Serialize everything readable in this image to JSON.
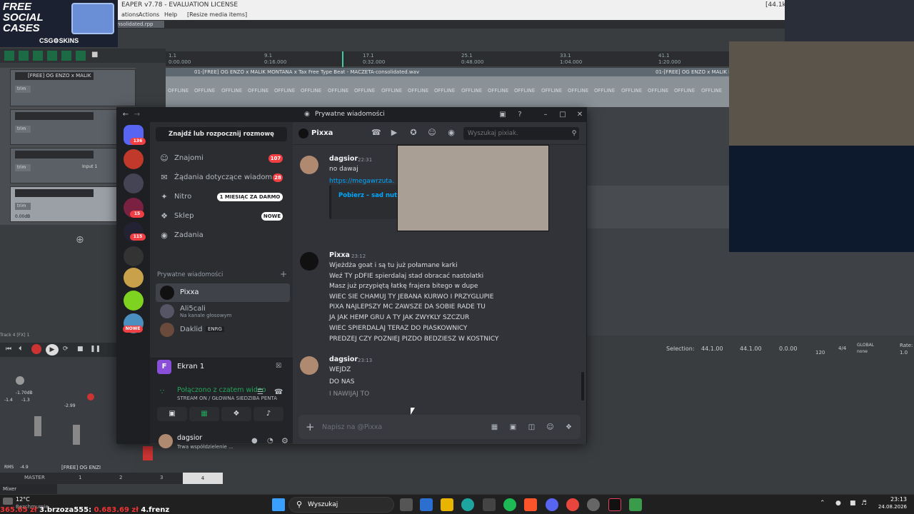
{
  "reaper": {
    "title": "EAPER v7.78 - EVALUATION LICENSE",
    "menu": [
      "ations",
      "Actions",
      "Help",
      "[Resize media items]"
    ],
    "samplerate": "[44.1kHz",
    "tab": "nsolidated.rpp",
    "ruler": [
      "1.1",
      "9.1",
      "17.1",
      "25.1",
      "33.1",
      "41.1"
    ],
    "ruler_times": [
      "0:00.000",
      "0:16.000",
      "0:32.000",
      "0:48.000",
      "1:04.000",
      "1:20.000"
    ],
    "clip_label": "01-[FREE] OG ENZO x MALIK MONTANA x Tax Free Type Beat - MACZETA-consolidated.wav",
    "clip_label2": "01-[FREE] OG ENZO x MALIK MONT",
    "offline": "OFFLINE",
    "track_names": [
      "[FREE] OG ENZO x MALIK",
      "",
      "",
      ""
    ],
    "trim": "trim",
    "input": "Input 1",
    "vol": "0.00dB",
    "selection": {
      "label": "Selection:",
      "start": "44.1.00",
      "end": "44.1.00",
      "len": "0.0.00"
    },
    "tempo": "120",
    "sig": "4/4",
    "global": "GLOBAL",
    "none": "none",
    "rate_label": "Rate:",
    "rate": "1.0",
    "mixer_tabs": [
      "MASTER",
      "1",
      "2",
      "3",
      "4"
    ],
    "mixer_track": "[FREE] OG ENZI",
    "mixer_label": "Mixer",
    "rms": "RMS",
    "rms_val": "-4.9",
    "meter_vals": [
      "-1.70dB",
      "-2.99",
      "-1.4",
      "-1.3"
    ],
    "track_label": "Track 4 [FX] 1"
  },
  "promo": {
    "text": "FREE SOCIAL CASES",
    "brand": "CSG⚙SKINS"
  },
  "discord": {
    "title": "Prywatne wiadomości",
    "find": "Znajdź lub rozpocznij rozmowę",
    "guild_badges": [
      "136",
      "15",
      "115",
      "NOWE"
    ],
    "nav": [
      {
        "label": "Znajomi",
        "badge": "107"
      },
      {
        "label": "Żądania dotyczące wiadom...",
        "badge": "28"
      },
      {
        "label": "Nitro",
        "badge": "1 MIESIĄC ZA DARMO"
      },
      {
        "label": "Sklep",
        "badge": "NOWE"
      },
      {
        "label": "Zadania",
        "badge": ""
      }
    ],
    "dm_header": "Prywatne wiadomości",
    "dms": [
      {
        "name": "Pixxa",
        "sub": ""
      },
      {
        "name": "Ali5cali",
        "sub": "Na kanale głosowym"
      },
      {
        "name": "Daklid",
        "sub": "",
        "tag": "ENRG"
      }
    ],
    "screen": {
      "label": "Ekran 1",
      "connected": "Połączono z czatem wideo",
      "channel": "STREAM ON / GŁOWNA SIEDZIBA PENTA"
    },
    "user": {
      "name": "dagsior",
      "status": "Trwa współdzielenie ..."
    },
    "chat": {
      "name": "Pixxa",
      "search": "Wyszukaj pixiak.",
      "placeholder": "Napisz na @Pixxa",
      "messages": [
        {
          "author": "dagsior",
          "time": "22:31",
          "lines": [
            "no dawaj"
          ]
        },
        {
          "author": "Pixxa",
          "time": "23:12",
          "lines": [
            "Wjeżdża goat i są tu już połamane karki",
            "Weź TY pDFIE spierdalaj stad obracać nastolatki",
            "Masz już przypiętą łatkę frajera bitego w dupe",
            "WIEC SIE CHAMUJ TY JEBANA KURWO I PRZYGLUPIE",
            "PIXA NAJLEPSZY MC ZAWSZE DA SOBIE RADE TU",
            "JA JAK HEMP GRU A  TY JAK ZWYKLY SZCZUR",
            "WIEC SPIERDALAJ TERAZ DO PIASKOWNICY",
            "PREDZEJ CZY POZNIEJ PIZDO BEDZIESZ W KOSTNICY"
          ]
        },
        {
          "author": "dagsior",
          "time": "23:13",
          "lines": [
            "WEJDZ",
            "DO NAS",
            "I NAWIJAJ TO"
          ]
        }
      ],
      "link": "https://megawrzuta.",
      "embed_title": "Pobierz – sad nuta"
    }
  },
  "taskbar": {
    "temp": "12°C",
    "weather": "Bezchmurnie",
    "search": "Wyszukaj",
    "time": "23:13",
    "date": "24.08.2026",
    "ticker": [
      {
        "text": "365.65 zł",
        "color": "#e33"
      },
      {
        "text": "3.brzoza555:",
        "color": "#fff"
      },
      {
        "text": "0.683.69 zł",
        "color": "#e33"
      },
      {
        "text": "4.frenz",
        "color": "#fff"
      }
    ]
  }
}
